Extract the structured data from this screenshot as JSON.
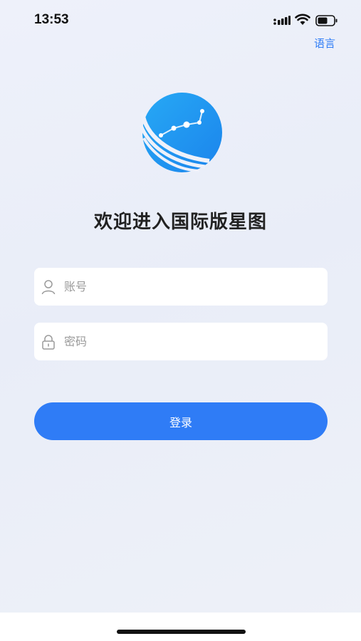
{
  "status_bar": {
    "time": "13:53"
  },
  "header": {
    "language_link": "语言"
  },
  "welcome": {
    "title": "欢迎进入国际版星图"
  },
  "form": {
    "account_placeholder": "账号",
    "password_placeholder": "密码",
    "login_label": "登录"
  },
  "colors": {
    "accent": "#2f7cf6",
    "logo_blue": "#1f9bf0"
  }
}
